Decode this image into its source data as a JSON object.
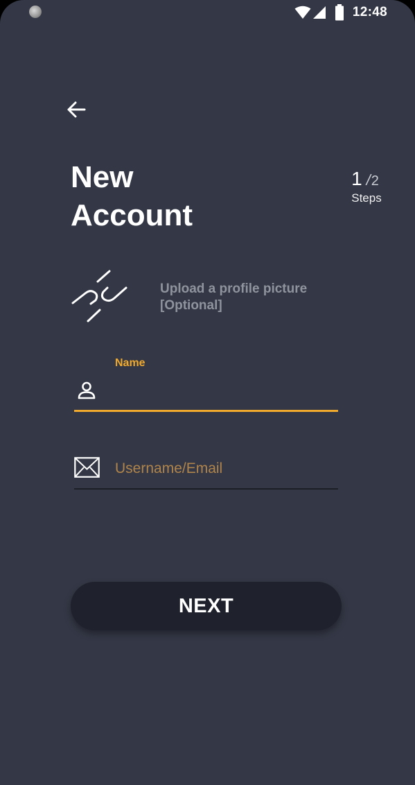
{
  "status_bar": {
    "time": "12:48",
    "icons": [
      "wifi-icon",
      "cell-signal-icon",
      "battery-icon"
    ]
  },
  "header": {
    "back_icon": "arrow-left-icon",
    "title_line1": "New",
    "title_line2": "Account"
  },
  "steps": {
    "current": "1",
    "separator": "/",
    "total": "2",
    "label": "Steps"
  },
  "upload": {
    "icon": "broken-link-icon",
    "line1": "Upload a profile picture",
    "line2": "[Optional]"
  },
  "form": {
    "name": {
      "label": "Name",
      "value": "",
      "icon": "person-icon"
    },
    "email": {
      "placeholder": "Username/Email",
      "value": "",
      "icon": "mail-icon"
    }
  },
  "actions": {
    "next_label": "NEXT"
  },
  "colors": {
    "background": "#343846",
    "accent": "#f0a92c",
    "button": "#1f222c",
    "muted_text": "#8f939d"
  }
}
